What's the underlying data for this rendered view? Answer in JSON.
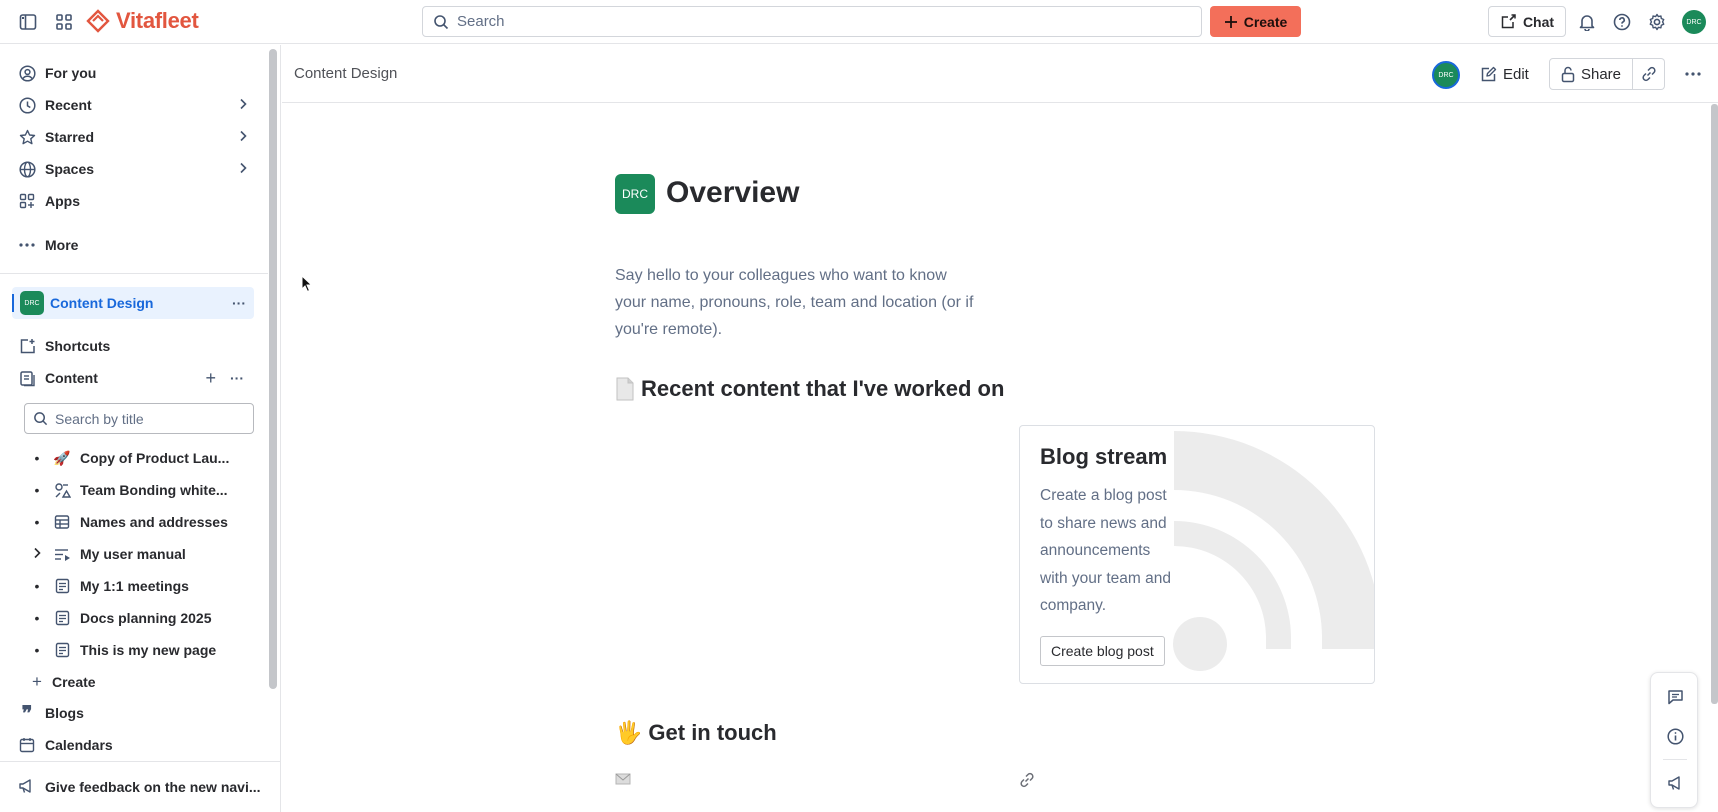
{
  "app": {
    "name": "Vitafleet",
    "brand_color": "#e2563f",
    "accent_color": "#1868db"
  },
  "topbar": {
    "search_placeholder": "Search",
    "create_label": "Create",
    "chat_label": "Chat",
    "avatar_initials": "DRC"
  },
  "sidebar": {
    "nav": [
      {
        "label": "For you",
        "icon": "person-circle-icon"
      },
      {
        "label": "Recent",
        "icon": "clock-icon"
      },
      {
        "label": "Starred",
        "icon": "star-icon"
      },
      {
        "label": "Spaces",
        "icon": "globe-icon"
      },
      {
        "label": "Apps",
        "icon": "apps-icon"
      },
      {
        "label": "More",
        "icon": "more-icon"
      }
    ],
    "space": {
      "label": "Content Design",
      "initials": "DRC"
    },
    "shortcuts_label": "Shortcuts",
    "content_label": "Content",
    "search_placeholder": "Search by title",
    "tree": [
      {
        "label": "Copy of Product Lau...",
        "icon": "rocket-icon"
      },
      {
        "label": "Team Bonding white...",
        "icon": "whiteboard-icon"
      },
      {
        "label": "Names and addresses",
        "icon": "table-icon"
      },
      {
        "label": "My user manual",
        "icon": "list-icon"
      },
      {
        "label": "My 1:1 meetings",
        "icon": "page-icon"
      },
      {
        "label": "Docs planning 2025",
        "icon": "page-icon"
      },
      {
        "label": "This is my new page",
        "icon": "page-icon"
      }
    ],
    "tree_create_label": "Create",
    "blogs_label": "Blogs",
    "calendars_label": "Calendars",
    "feedback_label": "Give feedback on the new navi..."
  },
  "page_header": {
    "breadcrumb": "Content Design",
    "avatar_initials": "DRC",
    "edit_label": "Edit",
    "share_label": "Share"
  },
  "page": {
    "icon_initials": "DRC",
    "title": "Overview",
    "intro": "Say hello to your colleagues who want to know your name, pronouns, role, team and location (or if you're remote).",
    "recent_heading": "Recent content that I've worked on",
    "blog_card": {
      "title": "Blog stream",
      "description": "Create a blog post to share news and announcements with your team and company.",
      "button_label": "Create blog post"
    },
    "contact_heading": "Get in touch",
    "contact_emoji": "🖐"
  }
}
